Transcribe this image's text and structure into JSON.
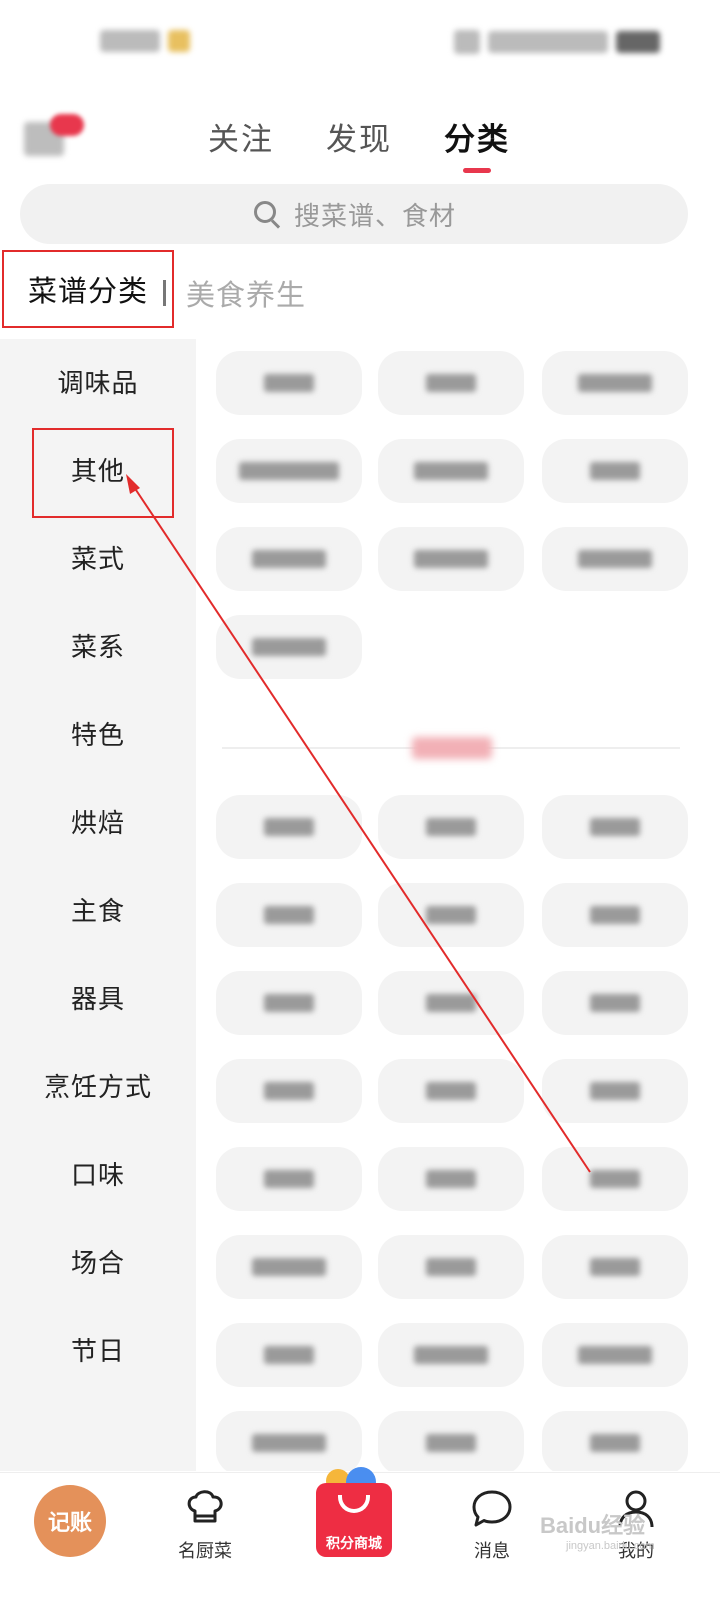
{
  "header": {
    "tabs": [
      {
        "label": "关注"
      },
      {
        "label": "发现"
      },
      {
        "label": "分类"
      }
    ],
    "active_tab": "分类"
  },
  "search": {
    "placeholder": "搜菜谱、食材"
  },
  "category_switch": {
    "tabs": [
      {
        "label": "菜谱分类"
      },
      {
        "label": "美食养生"
      }
    ],
    "active_tab": "菜谱分类"
  },
  "sidebar": {
    "items": [
      {
        "label": "调味品"
      },
      {
        "label": "其他"
      },
      {
        "label": "菜式"
      },
      {
        "label": "菜系"
      },
      {
        "label": "特色"
      },
      {
        "label": "烘焙"
      },
      {
        "label": "主食"
      },
      {
        "label": "器具"
      },
      {
        "label": "烹饪方式"
      },
      {
        "label": "口味"
      },
      {
        "label": "场合"
      },
      {
        "label": "节日"
      }
    ],
    "highlighted_item": "其他"
  },
  "bottom_nav": {
    "items": [
      {
        "label": "记账"
      },
      {
        "label": "名厨菜"
      },
      {
        "label": "积分商城"
      },
      {
        "label": "消息"
      },
      {
        "label": "我的"
      }
    ]
  },
  "watermark": {
    "text": "Baidu经验",
    "sub": "jingyan.baidu.com"
  },
  "colors": {
    "accent": "#e8374d",
    "annotation": "#e22b2b",
    "sidebar_bg": "#f4f4f4",
    "chip_bg": "#f3f3f3",
    "jizhang_bg": "#e4915a"
  }
}
